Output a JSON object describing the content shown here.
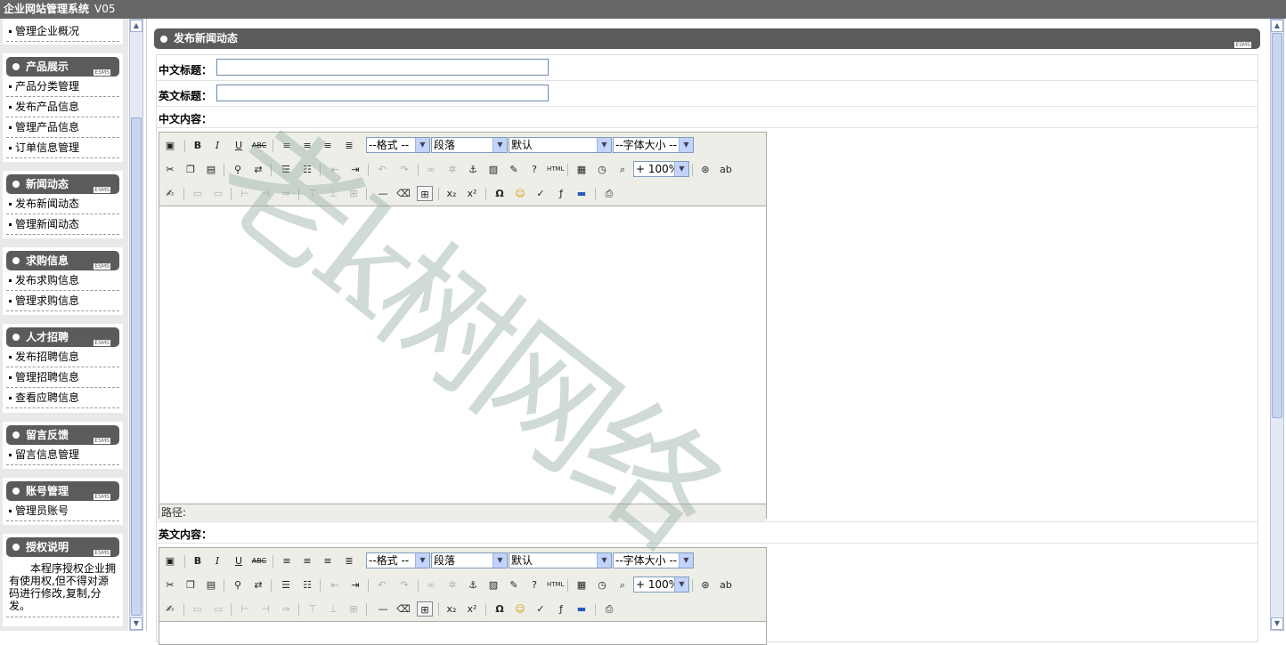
{
  "app": {
    "title": "企业网站管理系统",
    "version": "V05"
  },
  "sidebar": {
    "top_item": "管理企业概况",
    "sections": [
      {
        "title": "产品展示",
        "tag": "ESMS",
        "items": [
          "产品分类管理",
          "发布产品信息",
          "管理产品信息",
          "订单信息管理"
        ]
      },
      {
        "title": "新闻动态",
        "tag": "ESMS",
        "items": [
          "发布新闻动态",
          "管理新闻动态"
        ]
      },
      {
        "title": "求购信息",
        "tag": "ESMS",
        "items": [
          "发布求购信息",
          "管理求购信息"
        ]
      },
      {
        "title": "人才招聘",
        "tag": "ESMS",
        "items": [
          "发布招聘信息",
          "管理招聘信息",
          "查看应聘信息"
        ]
      },
      {
        "title": "留言反馈",
        "tag": "ESMS",
        "items": [
          "留言信息管理"
        ]
      },
      {
        "title": "账号管理",
        "tag": "ESMS",
        "items": [
          "管理员账号"
        ]
      },
      {
        "title": "授权说明",
        "tag": "ESMS",
        "text": "本程序授权企业拥有使用权,但不得对源码进行修改,复制,分发。"
      }
    ]
  },
  "main": {
    "heading": "发布新闻动态",
    "tag": "ESMS",
    "cn_title_label": "中文标题：",
    "cn_title_value": "",
    "en_title_label": "英文标题：",
    "en_title_value": "",
    "cn_content_label": "中文内容：",
    "en_content_label": "英文内容："
  },
  "editor": {
    "format_select": "--格式 --",
    "paragraph_select": "段落",
    "font_select": "默认",
    "size_select": "--字体大小 --",
    "zoom_select": "+ 100%",
    "path_label": "路径:"
  },
  "watermark": "老k树网络"
}
